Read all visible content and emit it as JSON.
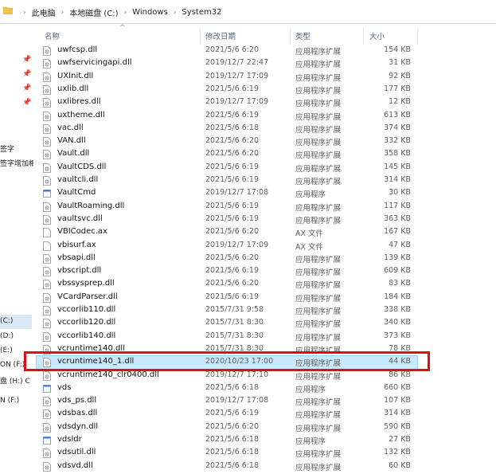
{
  "breadcrumb": [
    "此电脑",
    "本地磁盘 (C:)",
    "Windows",
    "System32"
  ],
  "breadcrumb_sep": "›",
  "columns": {
    "name": "名称",
    "date": "修改日期",
    "type": "类型",
    "size": "大小"
  },
  "nav": {
    "labels": [
      "签字",
      "签字增加相",
      "(C:)",
      "(D:)",
      "(E:)",
      "ON (F:)",
      "盘 (H:) C",
      "N (F:)"
    ]
  },
  "files": [
    {
      "name": "uwfcsp.dll",
      "date": "2021/5/6 6:20",
      "type": "应用程序扩展",
      "size": "154 KB",
      "icon": "dll-file-icon"
    },
    {
      "name": "uwfservicingapi.dll",
      "date": "2019/12/7 22:47",
      "type": "应用程序扩展",
      "size": "31 KB",
      "icon": "dll-file-icon"
    },
    {
      "name": "UXInit.dll",
      "date": "2019/12/7 17:09",
      "type": "应用程序扩展",
      "size": "92 KB",
      "icon": "dll-file-icon"
    },
    {
      "name": "uxlib.dll",
      "date": "2021/5/6 6:19",
      "type": "应用程序扩展",
      "size": "177 KB",
      "icon": "dll-file-icon"
    },
    {
      "name": "uxlibres.dll",
      "date": "2019/12/7 17:09",
      "type": "应用程序扩展",
      "size": "12 KB",
      "icon": "dll-file-icon"
    },
    {
      "name": "uxtheme.dll",
      "date": "2021/5/6 6:19",
      "type": "应用程序扩展",
      "size": "613 KB",
      "icon": "dll-file-icon"
    },
    {
      "name": "vac.dll",
      "date": "2021/5/6 6:18",
      "type": "应用程序扩展",
      "size": "374 KB",
      "icon": "dll-file-icon"
    },
    {
      "name": "VAN.dll",
      "date": "2021/5/6 6:20",
      "type": "应用程序扩展",
      "size": "332 KB",
      "icon": "dll-file-icon"
    },
    {
      "name": "Vault.dll",
      "date": "2021/5/6 6:20",
      "type": "应用程序扩展",
      "size": "358 KB",
      "icon": "dll-file-icon"
    },
    {
      "name": "VaultCDS.dll",
      "date": "2021/5/6 6:19",
      "type": "应用程序扩展",
      "size": "145 KB",
      "icon": "dll-file-icon"
    },
    {
      "name": "vaultcli.dll",
      "date": "2021/5/6 6:19",
      "type": "应用程序扩展",
      "size": "314 KB",
      "icon": "dll-file-icon"
    },
    {
      "name": "VaultCmd",
      "date": "2019/12/7 17:08",
      "type": "应用程序",
      "size": "30 KB",
      "icon": "exe-file-icon"
    },
    {
      "name": "VaultRoaming.dll",
      "date": "2021/5/6 6:19",
      "type": "应用程序扩展",
      "size": "117 KB",
      "icon": "dll-file-icon"
    },
    {
      "name": "vaultsvc.dll",
      "date": "2021/5/6 6:19",
      "type": "应用程序扩展",
      "size": "363 KB",
      "icon": "dll-file-icon"
    },
    {
      "name": "VBICodec.ax",
      "date": "2021/5/6 6:20",
      "type": "AX 文件",
      "size": "167 KB",
      "icon": "blank-file-icon"
    },
    {
      "name": "vbisurf.ax",
      "date": "2019/12/7 17:09",
      "type": "AX 文件",
      "size": "47 KB",
      "icon": "blank-file-icon"
    },
    {
      "name": "vbsapi.dll",
      "date": "2021/5/6 6:20",
      "type": "应用程序扩展",
      "size": "139 KB",
      "icon": "dll-file-icon"
    },
    {
      "name": "vbscript.dll",
      "date": "2021/5/6 6:19",
      "type": "应用程序扩展",
      "size": "609 KB",
      "icon": "dll-file-icon"
    },
    {
      "name": "vbssysprep.dll",
      "date": "2021/5/6 6:20",
      "type": "应用程序扩展",
      "size": "83 KB",
      "icon": "dll-file-icon"
    },
    {
      "name": "VCardParser.dll",
      "date": "2021/5/6 6:19",
      "type": "应用程序扩展",
      "size": "184 KB",
      "icon": "dll-file-icon"
    },
    {
      "name": "vccorlib110.dll",
      "date": "2015/7/31 9:58",
      "type": "应用程序扩展",
      "size": "338 KB",
      "icon": "dll-file-icon"
    },
    {
      "name": "vccorlib120.dll",
      "date": "2015/7/31 8:30",
      "type": "应用程序扩展",
      "size": "340 KB",
      "icon": "dll-file-icon"
    },
    {
      "name": "vccorlib140.dll",
      "date": "2015/7/31 8:30",
      "type": "应用程序扩展",
      "size": "373 KB",
      "icon": "dll-file-icon"
    },
    {
      "name": "vcruntime140.dll",
      "date": "2015/7/31 8:30",
      "type": "应用程序扩展",
      "size": "78 KB",
      "icon": "dll-file-icon"
    },
    {
      "name": "vcruntime140_1.dll",
      "date": "2020/10/23 17:00",
      "type": "应用程序扩展",
      "size": "44 KB",
      "icon": "dll-file-icon",
      "selected": true
    },
    {
      "name": "vcruntime140_clr0400.dll",
      "date": "2019/12/7 17:10",
      "type": "应用程序扩展",
      "size": "86 KB",
      "icon": "dll-file-icon"
    },
    {
      "name": "vds",
      "date": "2021/5/6 6:18",
      "type": "应用程序",
      "size": "660 KB",
      "icon": "exe-file-icon"
    },
    {
      "name": "vds_ps.dll",
      "date": "2019/12/7 17:08",
      "type": "应用程序扩展",
      "size": "107 KB",
      "icon": "dll-file-icon"
    },
    {
      "name": "vdsbas.dll",
      "date": "2021/5/6 6:19",
      "type": "应用程序扩展",
      "size": "314 KB",
      "icon": "dll-file-icon"
    },
    {
      "name": "vdsdyn.dll",
      "date": "2021/5/6 6:20",
      "type": "应用程序扩展",
      "size": "590 KB",
      "icon": "dll-file-icon"
    },
    {
      "name": "vdsldr",
      "date": "2021/5/6 6:18",
      "type": "应用程序",
      "size": "27 KB",
      "icon": "exe-file-icon"
    },
    {
      "name": "vdsutil.dll",
      "date": "2021/5/6 6:18",
      "type": "应用程序扩展",
      "size": "132 KB",
      "icon": "dll-file-icon"
    },
    {
      "name": "vdsvd.dll",
      "date": "2021/5/6 6:18",
      "type": "应用程序扩展",
      "size": "60 KB",
      "icon": "dll-file-icon"
    }
  ],
  "colors": {
    "selection": "#cce8ff",
    "highlight_box": "#e01010",
    "folder": "#f2c14e"
  }
}
